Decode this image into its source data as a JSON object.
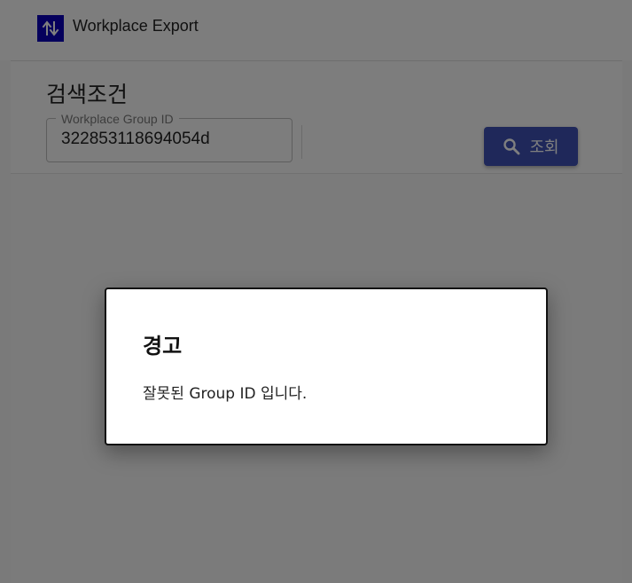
{
  "app": {
    "title": "Workplace Export",
    "logo_icon": "swap-vertical-icon",
    "brand_color": "#0b00b8"
  },
  "search": {
    "section_title": "검색조건",
    "field_label": "Workplace Group ID",
    "field_value": "322853118694054d",
    "button_label": "조회",
    "button_icon": "search-icon",
    "button_color": "#3f51b5"
  },
  "dialog": {
    "title": "경고",
    "message": "잘못된 Group ID 입니다."
  }
}
